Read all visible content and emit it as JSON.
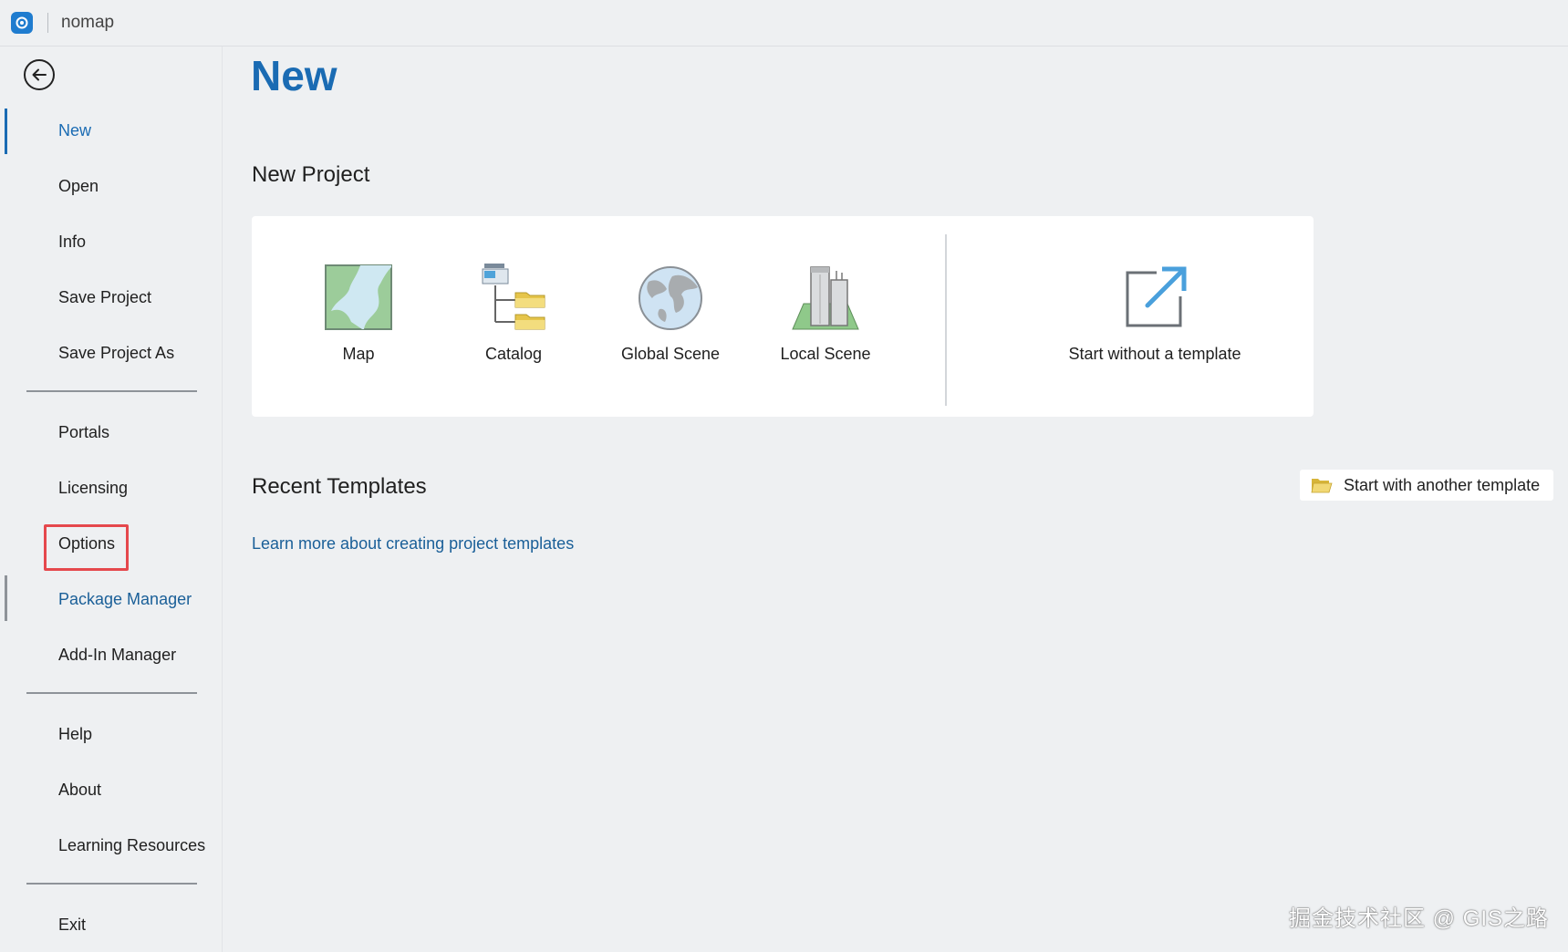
{
  "titlebar": {
    "title": "nomap"
  },
  "sidebar": {
    "items": [
      {
        "label": "New"
      },
      {
        "label": "Open"
      },
      {
        "label": "Info"
      },
      {
        "label": "Save Project"
      },
      {
        "label": "Save Project As"
      },
      {
        "label": "Portals"
      },
      {
        "label": "Licensing"
      },
      {
        "label": "Options"
      },
      {
        "label": "Package Manager"
      },
      {
        "label": "Add-In Manager"
      },
      {
        "label": "Help"
      },
      {
        "label": "About"
      },
      {
        "label": "Learning Resources"
      },
      {
        "label": "Exit"
      }
    ],
    "active": "New"
  },
  "main": {
    "title": "New",
    "new_project_heading": "New Project",
    "projects": [
      {
        "label": "Map",
        "icon": "map-icon"
      },
      {
        "label": "Catalog",
        "icon": "catalog-icon"
      },
      {
        "label": "Global Scene",
        "icon": "globe-icon"
      },
      {
        "label": "Local Scene",
        "icon": "local-scene-icon"
      },
      {
        "label": "Start without a template",
        "icon": "open-external-icon"
      }
    ],
    "recent_templates_heading": "Recent Templates",
    "start_with_template_label": "Start with another template",
    "learn_more_link": "Learn more about creating project templates"
  },
  "watermark": "掘金技术社区 @ GIS之路",
  "colors": {
    "accent": "#1a6bb3",
    "highlight": "#e5484d",
    "background": "#eef0f2"
  }
}
